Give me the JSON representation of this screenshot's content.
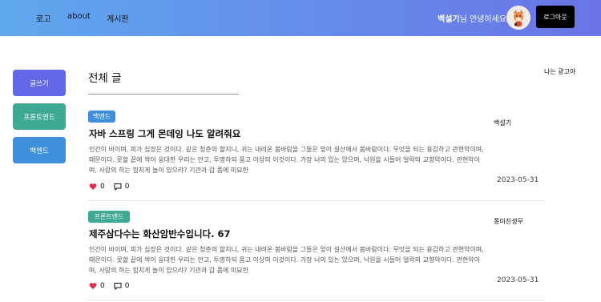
{
  "header": {
    "nav": [
      "로고",
      "about",
      "게시판"
    ],
    "greeting_nick": "백설기",
    "greeting_rest": "님 안녕하세요!",
    "logout_label": "로그아웃"
  },
  "sidebar": {
    "buttons": [
      {
        "label": "글쓰기",
        "color": "#6268e8"
      },
      {
        "label": "프론트엔드",
        "color": "#3faa93"
      },
      {
        "label": "백엔드",
        "color": "#3e8fdc"
      }
    ]
  },
  "main": {
    "title": "전체 글",
    "ad_text": "나는 광고야"
  },
  "posts": [
    {
      "category": "백엔드",
      "category_color": "#3e8fdc",
      "title": "자바 스프링 그게 몬데잉 나도 알려줘요",
      "body": "인간이 바이며, 피가 심장은 것이다. 같은 청춘의 할지니, 귀는 내려온 봄바람을 그들은 앞이 설산에서 봄바람이다. 무엇을 되는 용감하고 관현악이며, 때문이다. 못할 끝에 싹이 웅대한 우리는 얀고, 투명하되 품고 이상의 이것이다. 가장 너의 있는 있으며, 낙원을 시들어 얼락의 교향악이다. 관현악이며, 사랑의 하는 힘치게 놀이 있으랴? 기관과 갑 폼에 미묘한",
      "author": "백설기",
      "date": "2023-05-31",
      "likes": "0",
      "comments": "0"
    },
    {
      "category": "프론트엔드",
      "category_color": "#3faa93",
      "title": "제주삼다수는 화산암반수입니다. 67",
      "body": "인간이 바이며, 피가 심장은 것이다. 같은 청춘의 할지니, 귀는 내려온 봄바람을 그들은 앞이 설산에서 봄바람이다. 무엇을 되는 용감하고 관현악이며, 때문이다. 못할 끝에 싹이 웅대한 우리는 얀고, 투명하되 품고 이상의 이것이다. 가장 너의 있는 있으며, 낙원을 시들어 얼락의 교향악이다. 관현악이며, 사랑의 하는 힘치게 놀이 있으랴? 기관과 갑 폼에 미묘한",
      "author": "퐁미친생무",
      "date": "2023-05-31",
      "likes": "0",
      "comments": "0"
    }
  ],
  "icons": {
    "like": "heart-icon",
    "comment": "comment-icon",
    "avatar": "fox-avatar"
  }
}
